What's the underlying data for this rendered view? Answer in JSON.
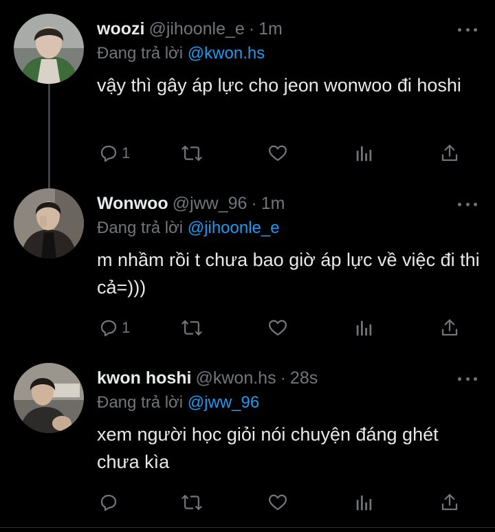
{
  "tweets": [
    {
      "name": "woozi",
      "handle": "@jihoonle_e",
      "dot": "·",
      "time": "1m",
      "reply_label": "Đang trả lời",
      "reply_mention": "@kwon.hs",
      "text": "vậy thì gây áp lực cho jeon wonwoo đi hoshi",
      "reply_count": "1",
      "retweet_count": "",
      "like_count": "",
      "avatar_icon": "user-avatar"
    },
    {
      "name": "Wonwoo",
      "handle": "@jww_96",
      "dot": "·",
      "time": "1m",
      "reply_label": "Đang trả lời",
      "reply_mention": "@jihoonle_e",
      "text": "m nhầm rồi t chưa bao giờ áp lực về việc đi thi cả=)))",
      "reply_count": "1",
      "retweet_count": "",
      "like_count": "",
      "avatar_icon": "user-avatar"
    },
    {
      "name": "kwon hoshi",
      "handle": "@kwon.hs",
      "dot": "·",
      "time": "28s",
      "reply_label": "Đang trả lời",
      "reply_mention": "@jww_96",
      "text": "xem người học giỏi nói chuyện đáng ghét chưa kìa",
      "reply_count": "",
      "retweet_count": "",
      "like_count": "",
      "avatar_icon": "user-avatar"
    }
  ],
  "icons": {
    "reply": "reply-icon",
    "retweet": "retweet-icon",
    "like": "heart-icon",
    "views": "analytics-icon",
    "share": "share-icon",
    "more": "more-icon"
  },
  "colors": {
    "background": "#000000",
    "text": "#e7e9ea",
    "muted": "#71767b",
    "link": "#1d9bf0",
    "thread_line": "#3e4144"
  }
}
